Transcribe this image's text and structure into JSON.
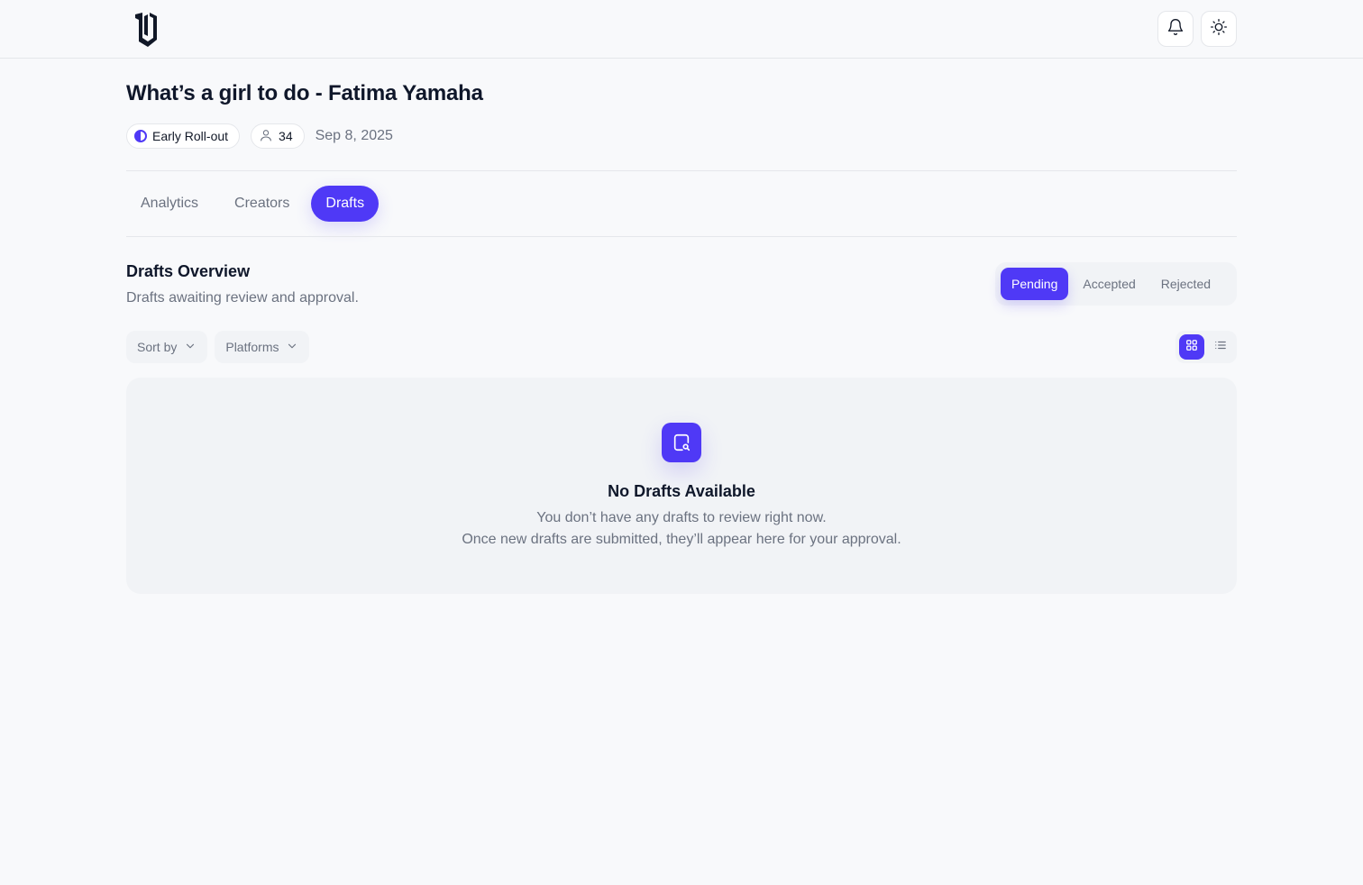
{
  "header": {
    "logo_icon": "brand-logo-icon",
    "notifications_icon": "bell-icon",
    "theme_icon": "sun-icon"
  },
  "page": {
    "title": "What’s a girl to do - Fatima Yamaha",
    "status_badge": "Early Roll-out",
    "creators_count": "34",
    "date": "Sep 8, 2025"
  },
  "tabs": [
    {
      "label": "Analytics",
      "active": false
    },
    {
      "label": "Creators",
      "active": false
    },
    {
      "label": "Drafts",
      "active": true
    }
  ],
  "drafts": {
    "title": "Drafts Overview",
    "subtitle": "Drafts awaiting review and approval.",
    "status_filters": [
      {
        "label": "Pending",
        "active": true
      },
      {
        "label": "Accepted",
        "active": false
      },
      {
        "label": "Rejected",
        "active": false
      }
    ],
    "sort_label": "Sort by",
    "platforms_label": "Platforms",
    "view_modes": [
      {
        "icon": "grid-icon",
        "active": true
      },
      {
        "icon": "list-icon",
        "active": false
      }
    ],
    "empty": {
      "icon": "document-search-icon",
      "title": "No Drafts Available",
      "line1": "You don’t have any drafts to review right now.",
      "line2": "Once new drafts are submitted, they’ll appear here for your approval."
    }
  },
  "colors": {
    "accent": "#4f39f6",
    "background": "#f8f9fb",
    "panel": "#f1f3f6",
    "muted_text": "#6b7280"
  }
}
